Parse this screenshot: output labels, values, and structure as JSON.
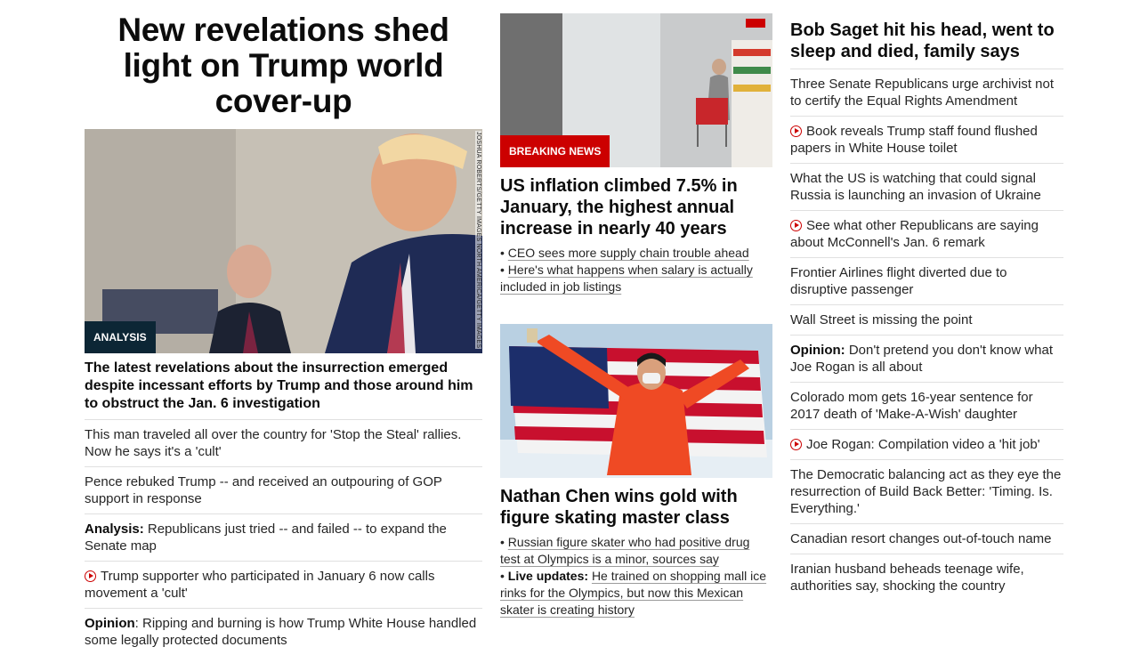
{
  "lead": {
    "title": "New revelations shed light on Trump world cover-up",
    "image_label": "ANALYSIS",
    "image_credit": "JOSHUA ROBERTS/GETTY IMAGES NORTH AMERICA/GETTY IMAGES",
    "subhead": "The latest revelations about the insurrection emerged despite incessant efforts by Trump and those around him to obstruct the Jan. 6 investigation",
    "items": [
      {
        "prefix": "",
        "text": "This man traveled all over the country for 'Stop the Steal' rallies. Now he says it's a 'cult'"
      },
      {
        "prefix": "",
        "text": "Pence rebuked Trump -- and received an outpouring of GOP support in response"
      },
      {
        "prefix": "Analysis:",
        "text": " Republicans just tried -- and failed -- to expand the Senate map"
      },
      {
        "prefix": "",
        "text": "Trump supporter who participated in January 6 now calls movement a 'cult'"
      },
      {
        "prefix": "Opinion",
        "text": ": Ripping and burning is how Trump White House handled some legally protected documents"
      }
    ]
  },
  "middle": {
    "story1": {
      "image_label": "BREAKING NEWS",
      "title": "US inflation climbed 7.5% in January, the highest annual increase in nearly 40 years",
      "bullets": [
        "CEO sees more supply chain trouble ahead",
        "Here's what happens when salary is actually included in job listings"
      ]
    },
    "story2": {
      "title": "Nathan Chen wins gold with figure skating master class",
      "bullets": [
        {
          "prefix": "",
          "text": "Russian figure skater who had positive drug test at Olympics is a minor, sources say"
        },
        {
          "prefix": "Live updates:",
          "text": "He trained on shopping mall ice rinks for the Olympics, but now this Mexican skater is creating history"
        }
      ]
    }
  },
  "right": {
    "title": "Bob Saget hit his head, went to sleep and died, family says",
    "items": [
      {
        "prefix": "",
        "text": "Three Senate Republicans urge archivist not to certify the Equal Rights Amendment"
      },
      {
        "prefix": "",
        "text": "Book reveals Trump staff found flushed papers in White House toilet"
      },
      {
        "prefix": "",
        "text": "What the US is watching that could signal Russia is launching an invasion of Ukraine"
      },
      {
        "prefix": "",
        "text": "See what other Republicans are saying about McConnell's Jan. 6 remark"
      },
      {
        "prefix": "",
        "text": "Frontier Airlines flight diverted due to disruptive passenger"
      },
      {
        "prefix": "",
        "text": "Wall Street is missing the point"
      },
      {
        "prefix": "Opinion:",
        "text": " Don't pretend you don't know what Joe Rogan is all about"
      },
      {
        "prefix": "",
        "text": "Colorado mom gets 16-year sentence for 2017 death of 'Make-A-Wish' daughter"
      },
      {
        "prefix": "",
        "text": "Joe Rogan: Compilation video a 'hit job'"
      },
      {
        "prefix": "",
        "text": "The Democratic balancing act as they eye the resurrection of Build Back Better: 'Timing. Is. Everything.'"
      },
      {
        "prefix": "",
        "text": "Canadian resort changes out-of-touch name"
      },
      {
        "prefix": "",
        "text": "Iranian husband beheads teenage wife, authorities say, shocking the country"
      }
    ]
  },
  "icons": {
    "video": "play-circle-icon"
  },
  "colors": {
    "accent_red": "#cc0000",
    "analysis_badge": "#0c2635",
    "text": "#262626"
  }
}
